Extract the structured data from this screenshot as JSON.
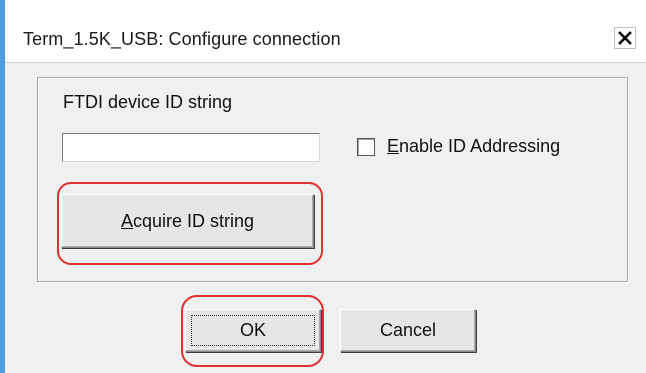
{
  "dialog": {
    "title": "Term_1.5K_USB: Configure connection",
    "close_icon": "close-x-icon"
  },
  "group": {
    "label": "FTDI device ID string",
    "id_input_value": "",
    "enable_checkbox": {
      "checked": false,
      "mnemonic": "E",
      "label_rest": "nable ID Addressing"
    },
    "acquire_button": {
      "mnemonic": "A",
      "label_rest": "cquire ID string"
    }
  },
  "buttons": {
    "ok": "OK",
    "cancel": "Cancel"
  },
  "colors": {
    "highlight": "#e03030",
    "accent_strip": "#4a9fe0",
    "dialog_bg": "#f0f0f0"
  }
}
